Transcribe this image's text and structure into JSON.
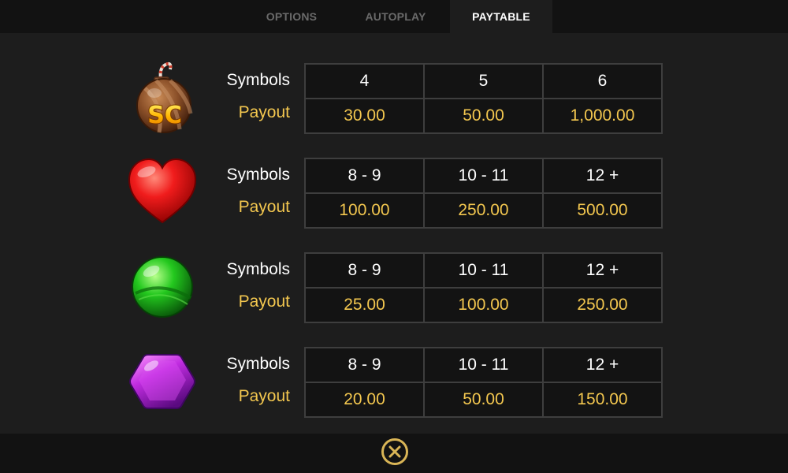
{
  "tabs": [
    {
      "label": "OPTIONS",
      "active": false
    },
    {
      "label": "AUTOPLAY",
      "active": false
    },
    {
      "label": "PAYTABLE",
      "active": true
    }
  ],
  "labels": {
    "symbols": "Symbols",
    "payout": "Payout"
  },
  "paytable": [
    {
      "symbol": "scatter-bomb-icon",
      "symbol_text": "SC",
      "counts": [
        "4",
        "5",
        "6"
      ],
      "payouts": [
        "30.00",
        "50.00",
        "1,000.00"
      ]
    },
    {
      "symbol": "red-heart-candy-icon",
      "counts": [
        "8 - 9",
        "10 - 11",
        "12 +"
      ],
      "payouts": [
        "100.00",
        "250.00",
        "500.00"
      ]
    },
    {
      "symbol": "green-round-candy-icon",
      "counts": [
        "8 - 9",
        "10 - 11",
        "12 +"
      ],
      "payouts": [
        "25.00",
        "100.00",
        "250.00"
      ]
    },
    {
      "symbol": "purple-hexagon-candy-icon",
      "counts": [
        "8 - 9",
        "10 - 11",
        "12 +"
      ],
      "payouts": [
        "20.00",
        "50.00",
        "150.00"
      ]
    }
  ],
  "colors": {
    "background": "#1d1d1d",
    "bar": "#121212",
    "cell_bg": "#131313",
    "cell_border": "#3e3e3e",
    "payout_gold": "#f3c74f",
    "close_gold": "#d9b556"
  },
  "close_icon": "close-icon"
}
